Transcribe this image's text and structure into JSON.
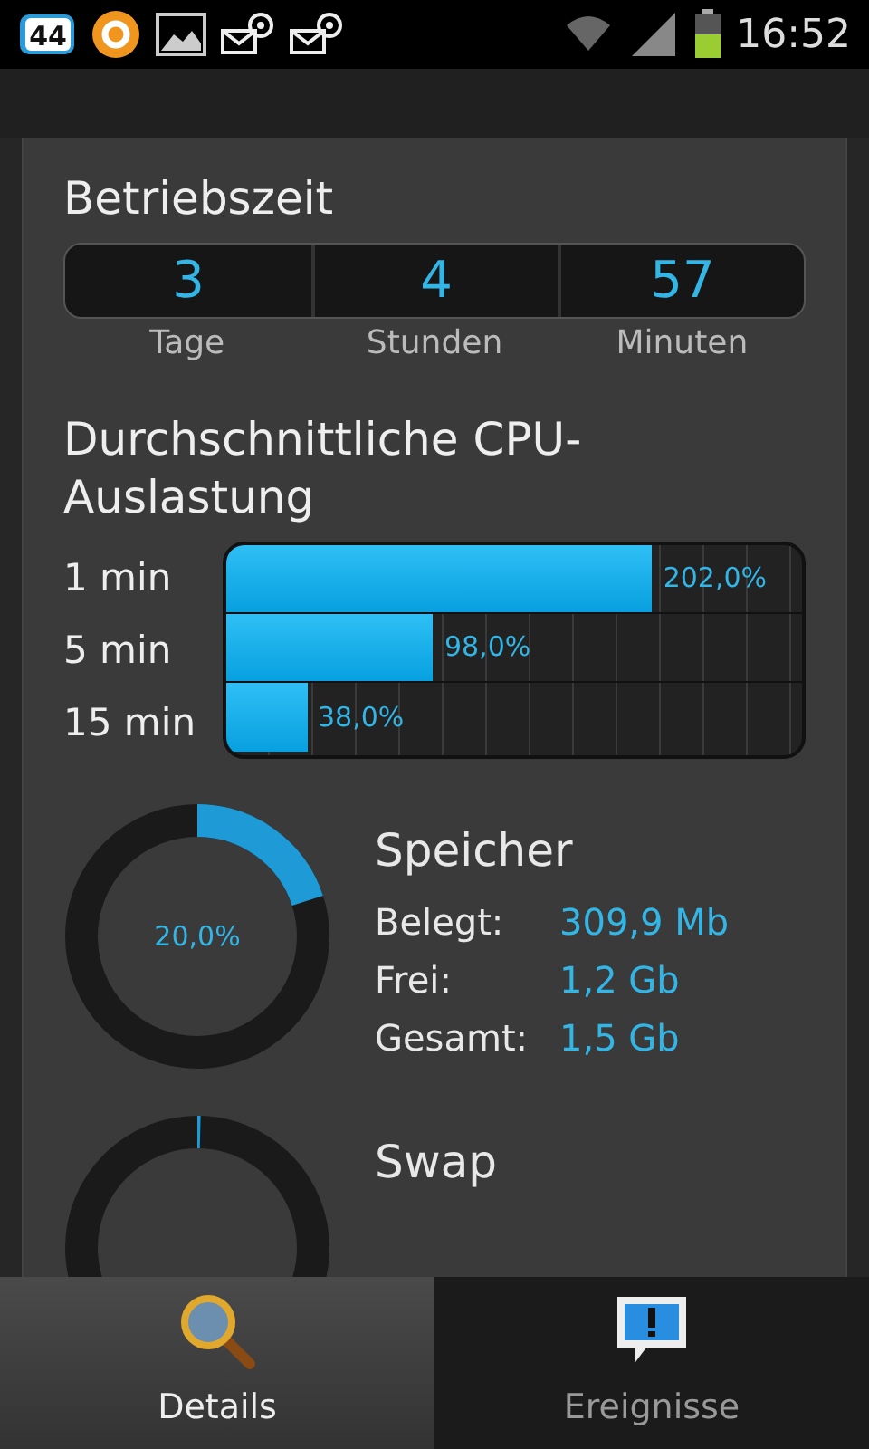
{
  "status_bar": {
    "notification_count": "44",
    "time": "16:52"
  },
  "uptime": {
    "title": "Betriebszeit",
    "cells": [
      {
        "value": "3",
        "unit": "Tage"
      },
      {
        "value": "4",
        "unit": "Stunden"
      },
      {
        "value": "57",
        "unit": "Minuten"
      }
    ]
  },
  "cpu": {
    "title": "Durchschnittliche CPU-Auslastung",
    "rows": [
      {
        "label": "1 min",
        "level": 0.74,
        "reading": "202,0%"
      },
      {
        "label": "5 min",
        "level": 0.36,
        "reading": "98,0%"
      },
      {
        "label": "15 min",
        "level": 0.14,
        "reading": "38,0%"
      }
    ]
  },
  "memory": [
    {
      "title": "Speicher",
      "level": 0.2,
      "reading": "20,0%",
      "rows": [
        {
          "label": "Belegt:",
          "value": "309,9 Mb"
        },
        {
          "label": "Frei:",
          "value": "1,2 Gb"
        },
        {
          "label": "Gesamt:",
          "value": "1,5 Gb"
        }
      ]
    },
    {
      "title": "Swap",
      "level": 0.004
    }
  ],
  "tabs": [
    {
      "label": "Details",
      "selected": true
    },
    {
      "label": "Ereignisse",
      "selected": false
    }
  ]
}
